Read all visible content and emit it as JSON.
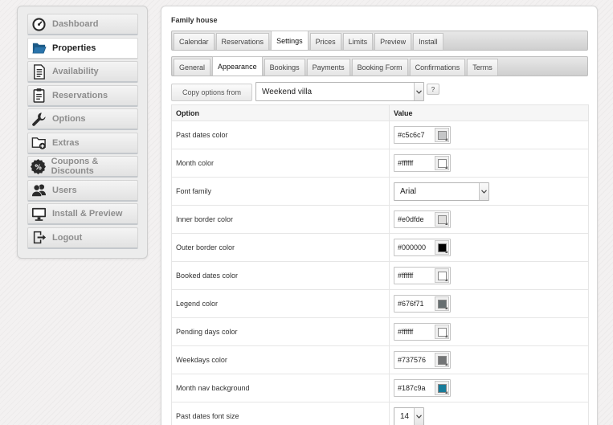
{
  "sidebar": {
    "items": [
      {
        "label": "Dashboard",
        "icon": "speedometer-icon",
        "active": false
      },
      {
        "label": "Properties",
        "icon": "folder-open-icon",
        "active": true
      },
      {
        "label": "Availability",
        "icon": "document-list-icon",
        "active": false
      },
      {
        "label": "Reservations",
        "icon": "clipboard-icon",
        "active": false
      },
      {
        "label": "Options",
        "icon": "wrench-icon",
        "active": false
      },
      {
        "label": "Extras",
        "icon": "folder-add-icon",
        "active": false
      },
      {
        "label": "Coupons & Discounts",
        "icon": "percent-icon",
        "active": false
      },
      {
        "label": "Users",
        "icon": "users-icon",
        "active": false
      },
      {
        "label": "Install & Preview",
        "icon": "monitor-icon",
        "active": false
      },
      {
        "label": "Logout",
        "icon": "logout-icon",
        "active": false
      }
    ]
  },
  "main": {
    "title": "Family house",
    "tabs": [
      {
        "label": "Calendar",
        "active": false
      },
      {
        "label": "Reservations",
        "active": false
      },
      {
        "label": "Settings",
        "active": true
      },
      {
        "label": "Prices",
        "active": false
      },
      {
        "label": "Limits",
        "active": false
      },
      {
        "label": "Preview",
        "active": false
      },
      {
        "label": "Install",
        "active": false
      }
    ],
    "subtabs": [
      {
        "label": "General",
        "active": false
      },
      {
        "label": "Appearance",
        "active": true
      },
      {
        "label": "Bookings",
        "active": false
      },
      {
        "label": "Payments",
        "active": false
      },
      {
        "label": "Booking Form",
        "active": false
      },
      {
        "label": "Confirmations",
        "active": false
      },
      {
        "label": "Terms",
        "active": false
      }
    ],
    "copy_button": "Copy options from",
    "copy_select_value": "Weekend villa",
    "help_label": "?",
    "table": {
      "headers": {
        "option": "Option",
        "value": "Value"
      },
      "rows": [
        {
          "label": "Past dates color",
          "type": "color",
          "value": "#c5c6c7",
          "swatch": "#c5c6c7"
        },
        {
          "label": "Month color",
          "type": "color",
          "value": "#ffffff",
          "swatch": "#ffffff"
        },
        {
          "label": "Font family",
          "type": "select",
          "value": "Arial"
        },
        {
          "label": "Inner border color",
          "type": "color",
          "value": "#e0dfde",
          "swatch": "#e0dfde"
        },
        {
          "label": "Outer border color",
          "type": "color",
          "value": "#000000",
          "swatch": "#000000"
        },
        {
          "label": "Booked dates color",
          "type": "color",
          "value": "#ffffff",
          "swatch": "#ffffff"
        },
        {
          "label": "Legend color",
          "type": "color",
          "value": "#676f71",
          "swatch": "#676f71"
        },
        {
          "label": "Pending days color",
          "type": "color",
          "value": "#ffffff",
          "swatch": "#ffffff"
        },
        {
          "label": "Weekdays color",
          "type": "color",
          "value": "#737576",
          "swatch": "#737576"
        },
        {
          "label": "Month nav background",
          "type": "color",
          "value": "#187c9a",
          "swatch": "#187c9a"
        },
        {
          "label": "Past dates font size",
          "type": "select-small",
          "value": "14"
        }
      ]
    }
  }
}
